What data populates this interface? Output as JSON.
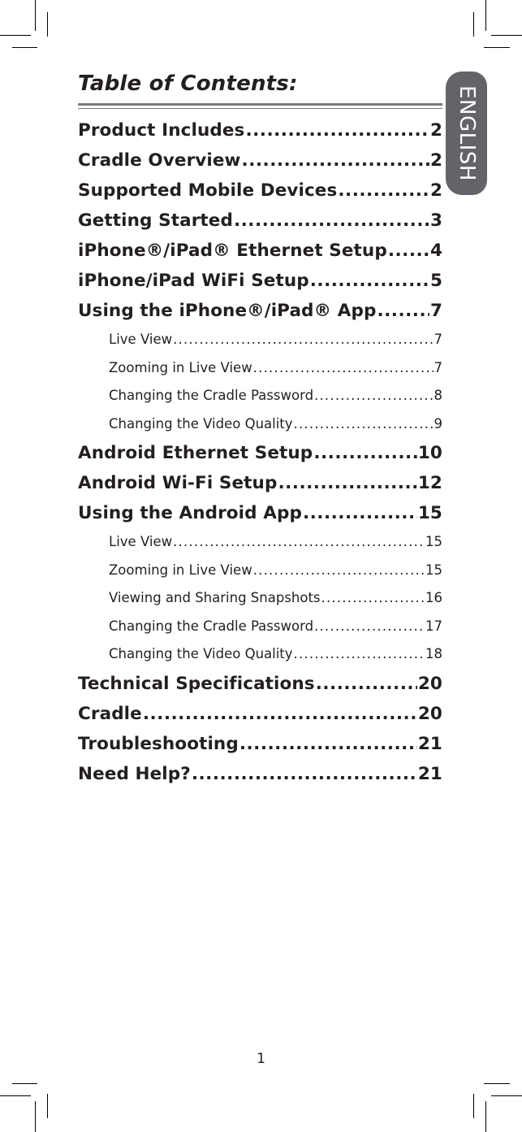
{
  "document": {
    "title": "Table of Contents:",
    "language_tab": "ENGLISH",
    "page_number": "1",
    "colors": {
      "text": "#231f20",
      "rule": "#7a7b7e",
      "tab_background": "#636469",
      "tab_text": "#ffffff"
    }
  },
  "toc": [
    {
      "level": 1,
      "label": "Product Includes",
      "page": "2"
    },
    {
      "level": 1,
      "label": "Cradle Overview",
      "page": "2"
    },
    {
      "level": 1,
      "label": "Supported Mobile Devices",
      "page": "2"
    },
    {
      "level": 1,
      "label": "Getting Started",
      "page": "3"
    },
    {
      "level": 1,
      "label": "iPhone®/iPad® Ethernet Setup",
      "page": "4"
    },
    {
      "level": 1,
      "label": "iPhone/iPad WiFi Setup",
      "page": "5"
    },
    {
      "level": 1,
      "label": "Using the iPhone®/iPad® App",
      "page": "7"
    },
    {
      "level": 2,
      "label": "Live View",
      "page": "7"
    },
    {
      "level": 2,
      "label": "Zooming in Live View",
      "page": "7"
    },
    {
      "level": 2,
      "label": "Changing the Cradle Password",
      "page": "8"
    },
    {
      "level": 2,
      "label": "Changing the Video Quality",
      "page": "9"
    },
    {
      "level": 1,
      "label": "Android Ethernet Setup",
      "page": "10"
    },
    {
      "level": 1,
      "label": "Android Wi-Fi Setup",
      "page": "12"
    },
    {
      "level": 1,
      "label": "Using the Android App",
      "page": "15"
    },
    {
      "level": 2,
      "label": "Live View",
      "page": "15"
    },
    {
      "level": 2,
      "label": "Zooming in Live View",
      "page": "15"
    },
    {
      "level": 2,
      "label": "Viewing and Sharing Snapshots",
      "page": "16"
    },
    {
      "level": 2,
      "label": "Changing the Cradle Password",
      "page": "17"
    },
    {
      "level": 2,
      "label": "Changing the Video Quality",
      "page": "18"
    },
    {
      "level": 1,
      "label": "Technical Specifications",
      "page": "20"
    },
    {
      "level": 1,
      "label": "Cradle",
      "page": "20"
    },
    {
      "level": 1,
      "label": "Troubleshooting",
      "page": "21"
    },
    {
      "level": 1,
      "label": "Need Help?",
      "page": "21"
    }
  ]
}
